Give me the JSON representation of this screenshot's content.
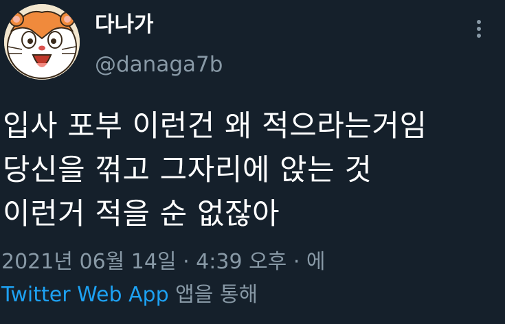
{
  "user": {
    "display_name": "다나가",
    "handle": "@danaga7b",
    "avatar_icon": "hamster-avatar-icon"
  },
  "header": {
    "more_icon": "more-vertical-icon"
  },
  "tweet": {
    "lines": [
      "입사 포부 이런건 왜 적으라는거임",
      "당신을 꺾고 그자리에 앉는 것",
      "이런거 적을 순 없잖아"
    ],
    "timestamp": "2021년 06월 14일 · 4:39 오후 · 에",
    "source_app": "Twitter Web App",
    "source_suffix": " 앱을 통해"
  },
  "colors": {
    "background": "#15202b",
    "text_primary": "#ffffff",
    "text_secondary": "#8899a6",
    "link": "#1da1f2"
  }
}
